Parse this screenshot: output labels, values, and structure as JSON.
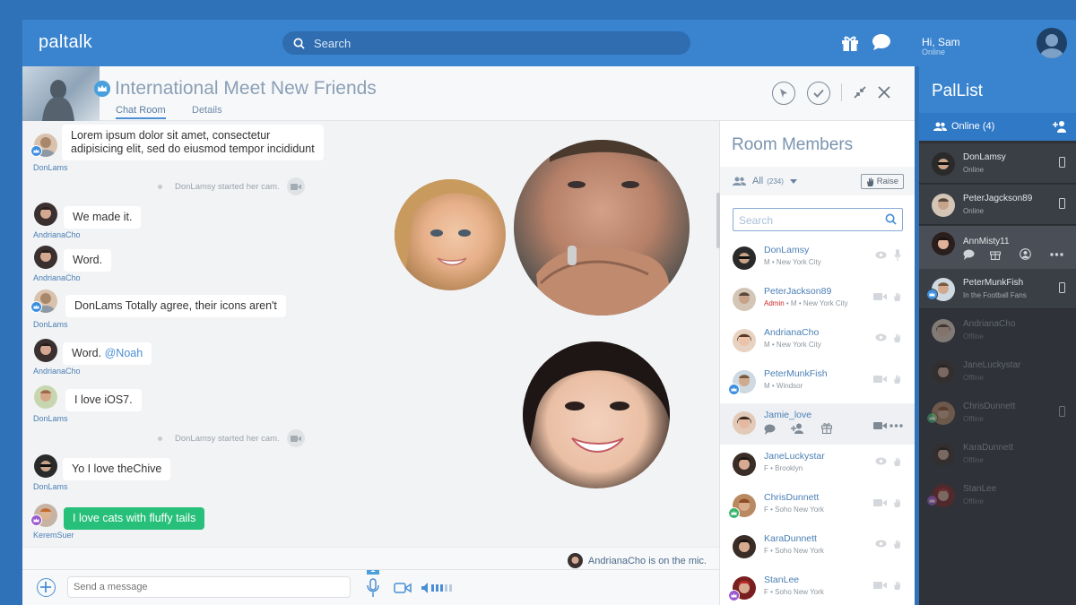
{
  "topbar": {
    "logo": "paltalk",
    "search_placeholder": "Search",
    "greeting": "Hi, Sam",
    "status": "Online"
  },
  "room": {
    "title": "International Meet New Friends",
    "tabs": [
      "Chat Room",
      "Details"
    ]
  },
  "chat": {
    "messages": [
      {
        "user": "DonLams",
        "text_line1": "Lorem ipsum dolor sit amet, consectetur",
        "text_line2": "adipisicing elit, sed do eiusmod tempor incididunt"
      },
      {
        "system": "DonLamsy started her cam."
      },
      {
        "user": "AndrianaCho",
        "text": "We made it."
      },
      {
        "user": "AndrianaCho",
        "text": "Word."
      },
      {
        "user": "DonLams",
        "text": "DonLams Totally agree, their icons aren't"
      },
      {
        "user": "AndrianaCho",
        "text": "Word.",
        "mention": "@Noah"
      },
      {
        "user": "DonLams",
        "text": "I love iOS7."
      },
      {
        "system": "DonLamsy started her cam."
      },
      {
        "user": "DonLams",
        "text": "Yo I love theChive"
      },
      {
        "user": "KeremSuer",
        "text": "I love cats with fluffy tails"
      }
    ],
    "mic_status": "AndrianaCho is on the mic.",
    "composer_placeholder": "Send a message"
  },
  "members": {
    "title": "Room Members",
    "filter_label": "All",
    "filter_count": "(234)",
    "raise_label": "Raise",
    "search_placeholder": "Search",
    "list": [
      {
        "name": "DonLamsy",
        "sub": "M • New York City"
      },
      {
        "name": "PeterJackson89",
        "admin": "Admin",
        "sub": " • M • New York City"
      },
      {
        "name": "AndrianaCho",
        "sub": "M • New York City"
      },
      {
        "name": "PeterMunkFish",
        "sub": "M • Windsor"
      },
      {
        "name": "Jamie_love",
        "sub": ""
      },
      {
        "name": "JaneLuckystar",
        "sub": "F • Brooklyn"
      },
      {
        "name": "ChrisDunnett",
        "sub": "F • Soho New York"
      },
      {
        "name": "KaraDunnett",
        "sub": "F • Soho New York"
      },
      {
        "name": "StanLee",
        "sub": "F • Soho New York"
      }
    ]
  },
  "pallist": {
    "title": "PalList",
    "online_label": "Online (4)",
    "pals": [
      {
        "name": "DonLamsy",
        "sub": "Online"
      },
      {
        "name": "PeterJagckson89",
        "sub": "Online"
      },
      {
        "name": "AnnMisty11",
        "sub": ""
      },
      {
        "name": "PeterMunkFish",
        "sub": "In the Football Fans"
      },
      {
        "name": "AndrianaCho",
        "sub": "Offline"
      },
      {
        "name": "JaneLuckystar",
        "sub": "Offline"
      },
      {
        "name": "ChrisDunnett",
        "sub": "Offline"
      },
      {
        "name": "KaraDunnett",
        "sub": "Offline"
      },
      {
        "name": "StanLee",
        "sub": "Offline"
      }
    ]
  },
  "colors": {
    "brand_blue": "#3a84cf",
    "green_bubble": "#27c07a",
    "admin_red": "#c92a2a",
    "pallist_bg": "#2f3238"
  }
}
